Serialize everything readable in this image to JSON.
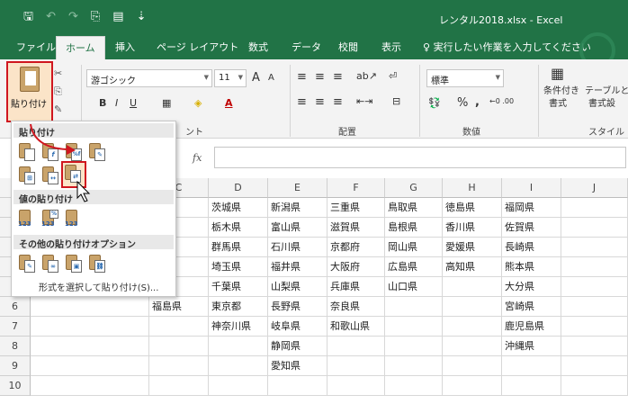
{
  "app": {
    "window_title": "レンタル2018.xlsx  -  Excel",
    "qat_icons": [
      "save-icon",
      "undo-icon",
      "redo-icon",
      "paste-format-icon",
      "form-icon",
      "customize-icon"
    ]
  },
  "menu": {
    "tabs": [
      "ファイル",
      "ホーム",
      "挿入",
      "ページ レイアウト",
      "数式",
      "データ",
      "校閲",
      "表示"
    ],
    "active_tab": "ホーム",
    "search_hint": "実行したい作業を入力してください"
  },
  "ribbon": {
    "paste_label": "貼り付け",
    "font_name": "游ゴシック",
    "font_size": "11",
    "grow": "A",
    "shrink": "A",
    "bold": "B",
    "italic": "I",
    "underline": "U",
    "font_color": "A",
    "number_format": "標準",
    "percent": "%",
    "comma": ",",
    "groups": {
      "font": "ント",
      "alignment": "配置",
      "number": "数値",
      "style": "スタイル"
    },
    "cond_format_label_1": "条件付き",
    "cond_format_label_2": "書式",
    "table_format_label_1": "テーブルと",
    "table_format_label_2": "書式設"
  },
  "formula_bar": {
    "fx": "fx",
    "value": ""
  },
  "sheet": {
    "columns": [
      "C",
      "D",
      "E",
      "F",
      "G",
      "H",
      "I",
      "J"
    ],
    "rows": [
      "6",
      "7",
      "8",
      "9",
      "10"
    ],
    "cells": {
      "r1": [
        "県",
        "茨城県",
        "新潟県",
        "三重県",
        "鳥取県",
        "徳島県",
        "福岡県",
        ""
      ],
      "r2": [
        "県",
        "栃木県",
        "富山県",
        "滋賀県",
        "島根県",
        "香川県",
        "佐賀県",
        ""
      ],
      "r3": [
        "県",
        "群馬県",
        "石川県",
        "京都府",
        "岡山県",
        "愛媛県",
        "長崎県",
        ""
      ],
      "r4": [
        "県",
        "埼玉県",
        "福井県",
        "大阪府",
        "広島県",
        "高知県",
        "熊本県",
        ""
      ],
      "r5": [
        "県",
        "千葉県",
        "山梨県",
        "兵庫県",
        "山口県",
        "",
        "大分県",
        ""
      ],
      "r6": [
        "福島県",
        "東京都",
        "長野県",
        "奈良県",
        "",
        "",
        "宮崎県",
        ""
      ],
      "r7": [
        "",
        "神奈川県",
        "岐阜県",
        "和歌山県",
        "",
        "",
        "鹿児島県",
        ""
      ],
      "r8": [
        "",
        "",
        "静岡県",
        "",
        "",
        "",
        "沖縄県",
        ""
      ],
      "r9": [
        "",
        "",
        "愛知県",
        "",
        "",
        "",
        "",
        ""
      ],
      "r10": [
        "",
        "",
        "",
        "",
        "",
        "",
        "",
        ""
      ]
    }
  },
  "paste_menu": {
    "section_paste": "貼り付け",
    "section_values": "値の貼り付け",
    "section_other": "その他の貼り付けオプション",
    "value_badge": "123",
    "value_badge_pct": "%",
    "special_link": "形式を選択して貼り付け(S)..."
  }
}
